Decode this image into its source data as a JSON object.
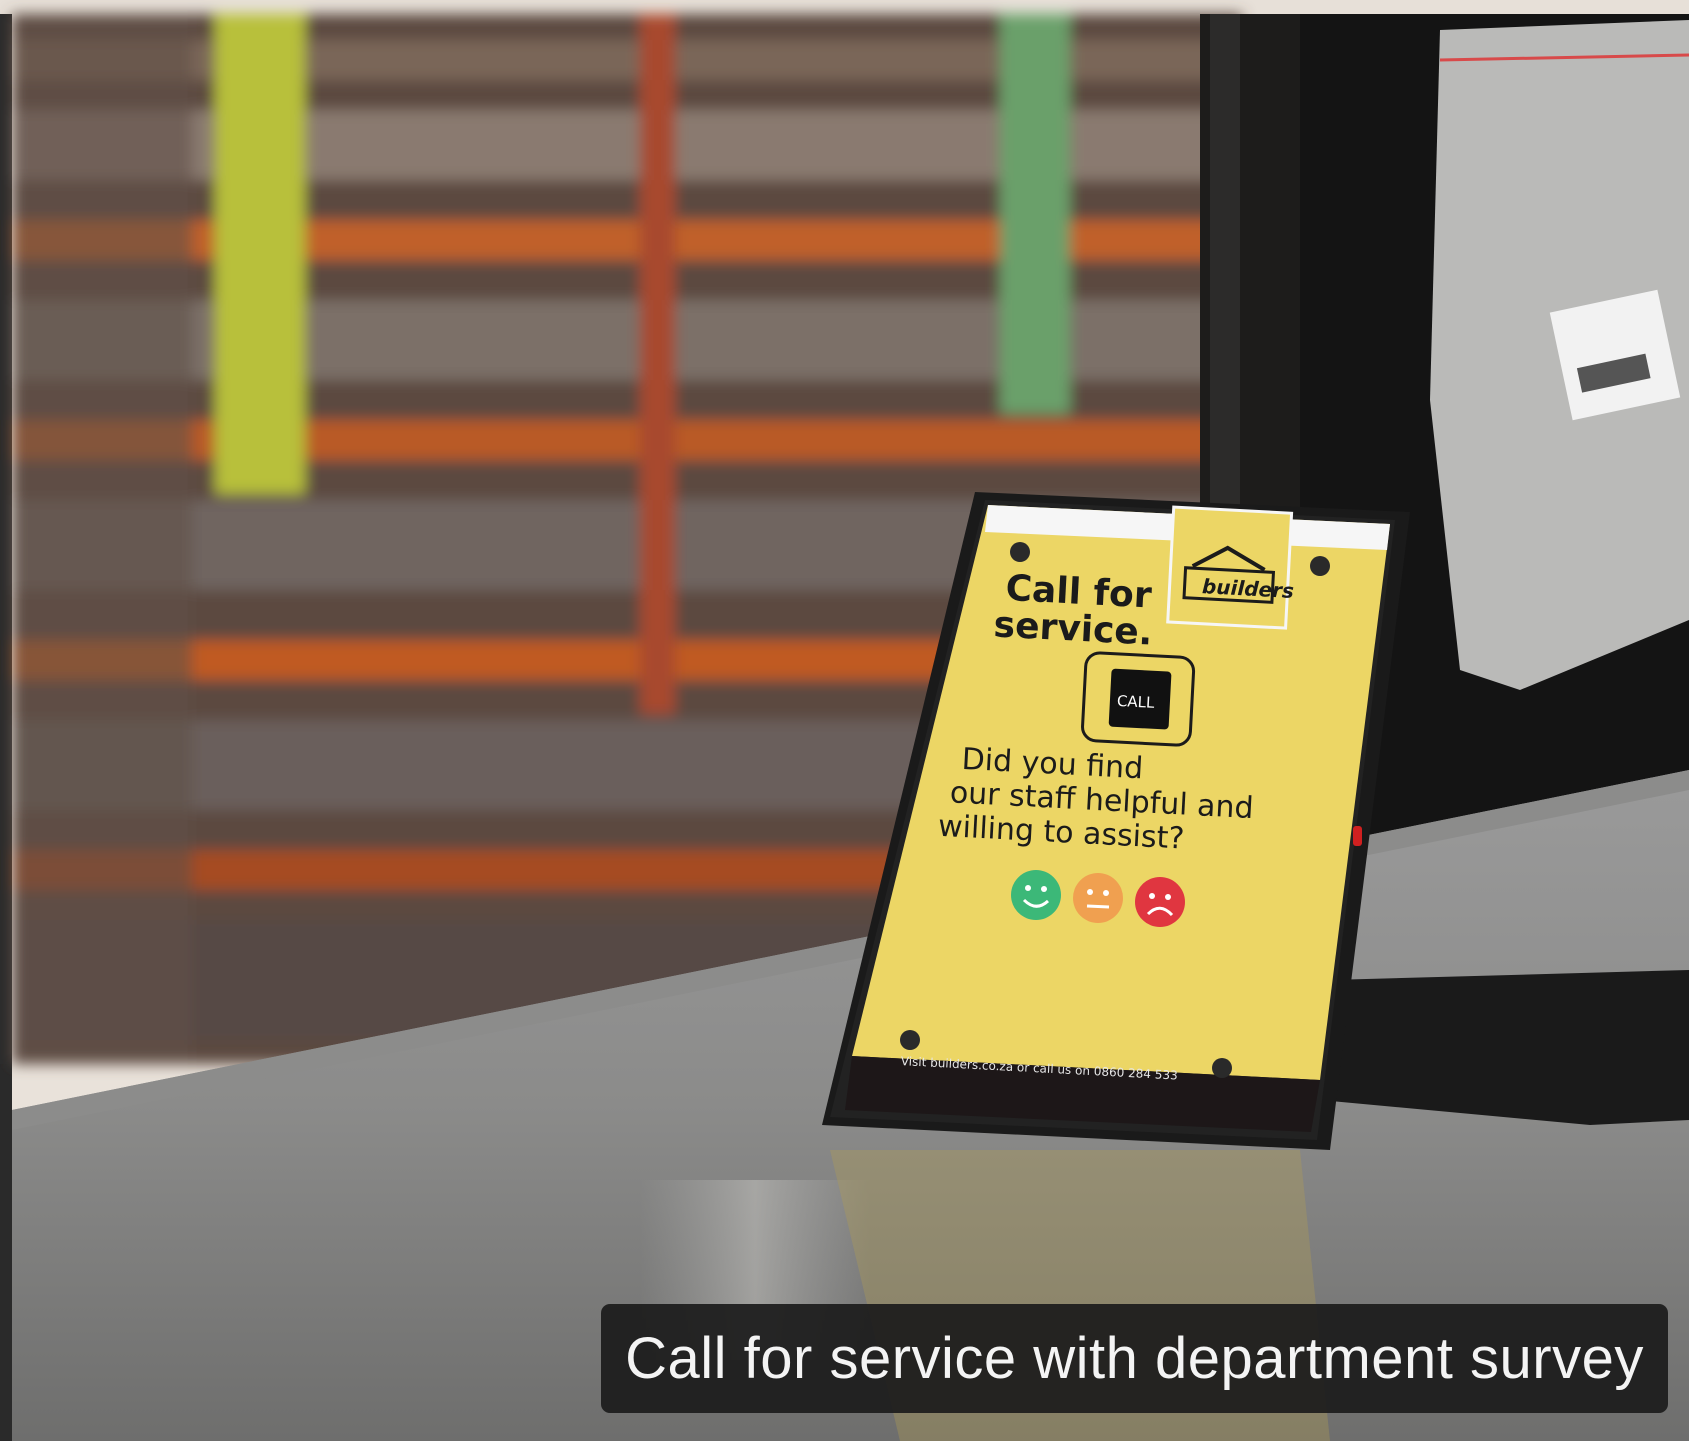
{
  "caption": "Call for service with department survey",
  "sign": {
    "heading_line1": "Call for",
    "heading_line2": "service.",
    "brand": "builders",
    "call_button": "CALL",
    "question_line1": "Did you find",
    "question_line2": "our staff helpful and",
    "question_line3": "willing to assist?",
    "footer": "Visit builders.co.za or call us on 0860 284 533"
  },
  "colors": {
    "sign_yellow": "#ecd665",
    "happy_face": "#3cb878",
    "neutral_face": "#f0a050",
    "sad_face": "#e03640"
  }
}
